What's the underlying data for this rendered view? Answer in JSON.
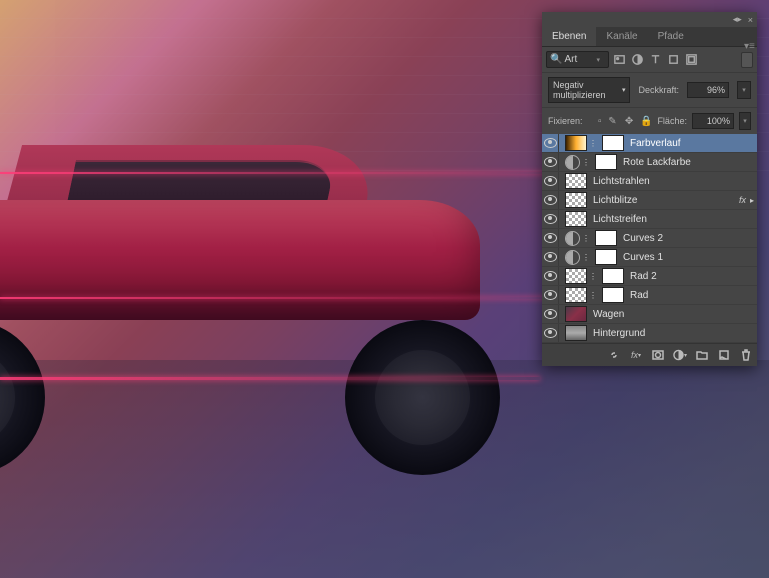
{
  "tabs": {
    "ebenen": "Ebenen",
    "kanaele": "Kanäle",
    "pfade": "Pfade"
  },
  "filter": {
    "label": "Art"
  },
  "blend": {
    "mode": "Negativ multiplizieren"
  },
  "opacity": {
    "label": "Deckkraft:",
    "value": "96%"
  },
  "lock": {
    "label": "Fixieren:"
  },
  "fill": {
    "label": "Fläche:",
    "value": "100%"
  },
  "layers": {
    "items": [
      {
        "name": "Farbverlauf",
        "type": "gradient",
        "selected": true,
        "hasMask": true,
        "link": true
      },
      {
        "name": "Rote Lackfarbe",
        "type": "adj",
        "hasMask": true,
        "link": true
      },
      {
        "name": "Lichtstrahlen",
        "type": "checker"
      },
      {
        "name": "Lichtblitze",
        "type": "checker",
        "fx": true
      },
      {
        "name": "Lichtstreifen",
        "type": "checker"
      },
      {
        "name": "Curves 2",
        "type": "adj",
        "hasMask": true,
        "link": true
      },
      {
        "name": "Curves 1",
        "type": "adj",
        "hasMask": true,
        "link": true
      },
      {
        "name": "Rad 2",
        "type": "checker",
        "hasMask": true,
        "link": true
      },
      {
        "name": "Rad",
        "type": "checker",
        "hasMask": true,
        "link": true
      },
      {
        "name": "Wagen",
        "type": "image-red"
      },
      {
        "name": "Hintergrund",
        "type": "image-bg"
      }
    ]
  },
  "fxLabel": "fx"
}
